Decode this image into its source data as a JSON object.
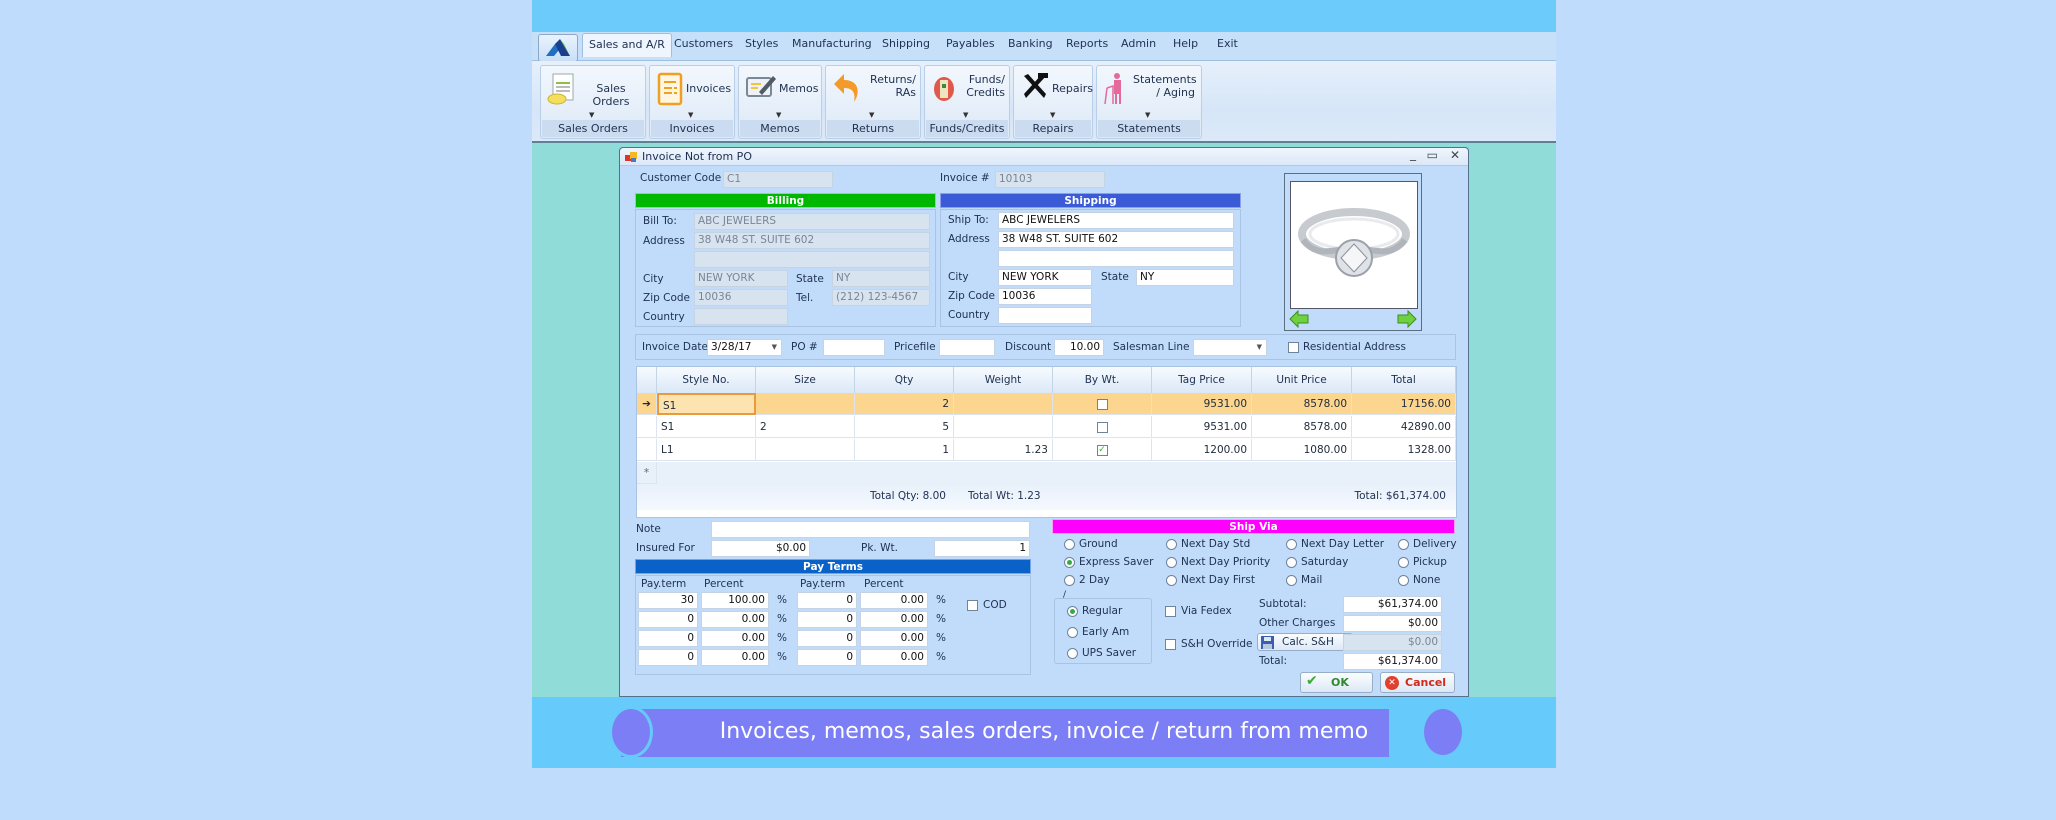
{
  "menubar": {
    "items": [
      "Sales and A/R",
      "Customers",
      "Styles",
      "Manufacturing",
      "Shipping",
      "Payables",
      "Banking",
      "Reports",
      "Admin",
      "Help",
      "Exit"
    ],
    "active": "Sales and A/R"
  },
  "ribbon": {
    "groups": [
      {
        "button": "Sales Orders",
        "footer": "Sales Orders",
        "icon": "sales-orders-icon"
      },
      {
        "button": "Invoices",
        "footer": "Invoices",
        "icon": "invoice-icon"
      },
      {
        "button": "Memos",
        "footer": "Memos",
        "icon": "memo-icon"
      },
      {
        "button_line1": "Returns/",
        "button_line2": "RAs",
        "footer": "Returns",
        "icon": "return-arrow-icon"
      },
      {
        "button_line1": "Funds/",
        "button_line2": "Credits",
        "footer": "Funds/Credits",
        "icon": "funds-icon"
      },
      {
        "button": "Repairs",
        "footer": "Repairs",
        "icon": "tools-icon"
      },
      {
        "button_line1": "Statements",
        "button_line2": "/ Aging",
        "footer": "Statements",
        "icon": "walker-icon"
      }
    ]
  },
  "dialog": {
    "title": "Invoice Not from PO",
    "customer_code_label": "Customer Code",
    "customer_code": "C1",
    "invoice_no_label": "Invoice #",
    "invoice_no": "10103",
    "billing": {
      "header": "Billing",
      "header_color": "#00b800",
      "bill_to_label": "Bill To:",
      "bill_to": "ABC JEWELERS",
      "address_label": "Address",
      "address1": "38 W48 ST. SUITE 602",
      "address2": "",
      "city_label": "City",
      "city": "NEW YORK",
      "state_label": "State",
      "state": "NY",
      "zip_label": "Zip Code",
      "zip": "10036",
      "tel_label": "Tel.",
      "tel": "(212) 123-4567",
      "country_label": "Country",
      "country": ""
    },
    "shipping": {
      "header": "Shipping",
      "header_color": "#3b5bd6",
      "ship_to_label": "Ship To:",
      "ship_to": "ABC JEWELERS",
      "address_label": "Address",
      "address1": "38 W48 ST. SUITE 602",
      "address2": "",
      "city_label": "City",
      "city": "NEW YORK",
      "state_label": "State",
      "state": "NY",
      "zip_label": "Zip Code",
      "zip": "10036",
      "country_label": "Country",
      "country": ""
    },
    "filters": {
      "invoice_date_label": "Invoice Date",
      "invoice_date": "3/28/17",
      "po_label": "PO #",
      "po": "",
      "pricefile_label": "Pricefile",
      "pricefile": "",
      "discount_label": "Discount",
      "discount": "10.00",
      "salesman_label": "Salesman Line",
      "salesman": "",
      "residential_label": "Residential Address",
      "residential_checked": false
    },
    "grid": {
      "columns": [
        "Style No.",
        "Size",
        "Qty",
        "Weight",
        "By Wt.",
        "Tag Price",
        "Unit Price",
        "Total"
      ],
      "rows": [
        {
          "style": "S1",
          "size": "",
          "qty": "2",
          "weight": "",
          "by_wt": false,
          "tag": "9531.00",
          "unit": "8578.00",
          "total": "17156.00",
          "selected": true
        },
        {
          "style": "S1",
          "size": "2",
          "qty": "5",
          "weight": "",
          "by_wt": false,
          "tag": "9531.00",
          "unit": "8578.00",
          "total": "42890.00",
          "selected": false
        },
        {
          "style": "L1",
          "size": "",
          "qty": "1",
          "weight": "1.23",
          "by_wt": true,
          "tag": "1200.00",
          "unit": "1080.00",
          "total": "1328.00",
          "selected": false
        }
      ],
      "new_row_marker": "*",
      "total_qty": "Total Qty: 8.00",
      "total_wt": "Total Wt: 1.23",
      "total": "Total: $61,374.00"
    },
    "note_label": "Note",
    "note": "",
    "insured_label": "Insured For",
    "insured": "$0.00",
    "pkwt_label": "Pk. Wt.",
    "pkwt": "1",
    "pay_terms": {
      "header": "Pay Terms",
      "header_color": "#0a62c8",
      "col_payterm": "Pay.term",
      "col_percent": "Percent",
      "pct_sign": "%",
      "left": [
        {
          "term": "30",
          "pct": "100.00"
        },
        {
          "term": "0",
          "pct": "0.00"
        },
        {
          "term": "0",
          "pct": "0.00"
        },
        {
          "term": "0",
          "pct": "0.00"
        }
      ],
      "right": [
        {
          "term": "0",
          "pct": "0.00"
        },
        {
          "term": "0",
          "pct": "0.00"
        },
        {
          "term": "0",
          "pct": "0.00"
        },
        {
          "term": "0",
          "pct": "0.00"
        }
      ],
      "cod_label": "COD",
      "cod_checked": false
    },
    "ship_via": {
      "header": "Ship Via",
      "header_color": "#ff00ff",
      "options": [
        [
          "Ground",
          "Next Day Std",
          "Next Day Letter",
          "Delivery"
        ],
        [
          "Express Saver",
          "Next Day Priority",
          "Saturday",
          "Pickup"
        ],
        [
          "2 Day",
          "Next Day First",
          "Mail",
          "None"
        ]
      ],
      "selected": "Express Saver",
      "service_group_title": "/",
      "service_options": [
        "Regular",
        "Early Am",
        "UPS Saver"
      ],
      "service_selected": "Regular",
      "via_fedex_label": "Via Fedex",
      "sh_override_label": "S&H Override"
    },
    "totals": {
      "subtotal_label": "Subtotal:",
      "subtotal": "$61,374.00",
      "other_label": "Other Charges",
      "other": "$0.00",
      "calc_label": "Calc. S&H",
      "calc_value": "$0.00",
      "total_label": "Total:",
      "total": "$61,374.00"
    },
    "ok_label": "OK",
    "cancel_label": "Cancel"
  },
  "banner": {
    "text": "Invoices, memos, sales orders, invoice / return from memo"
  }
}
